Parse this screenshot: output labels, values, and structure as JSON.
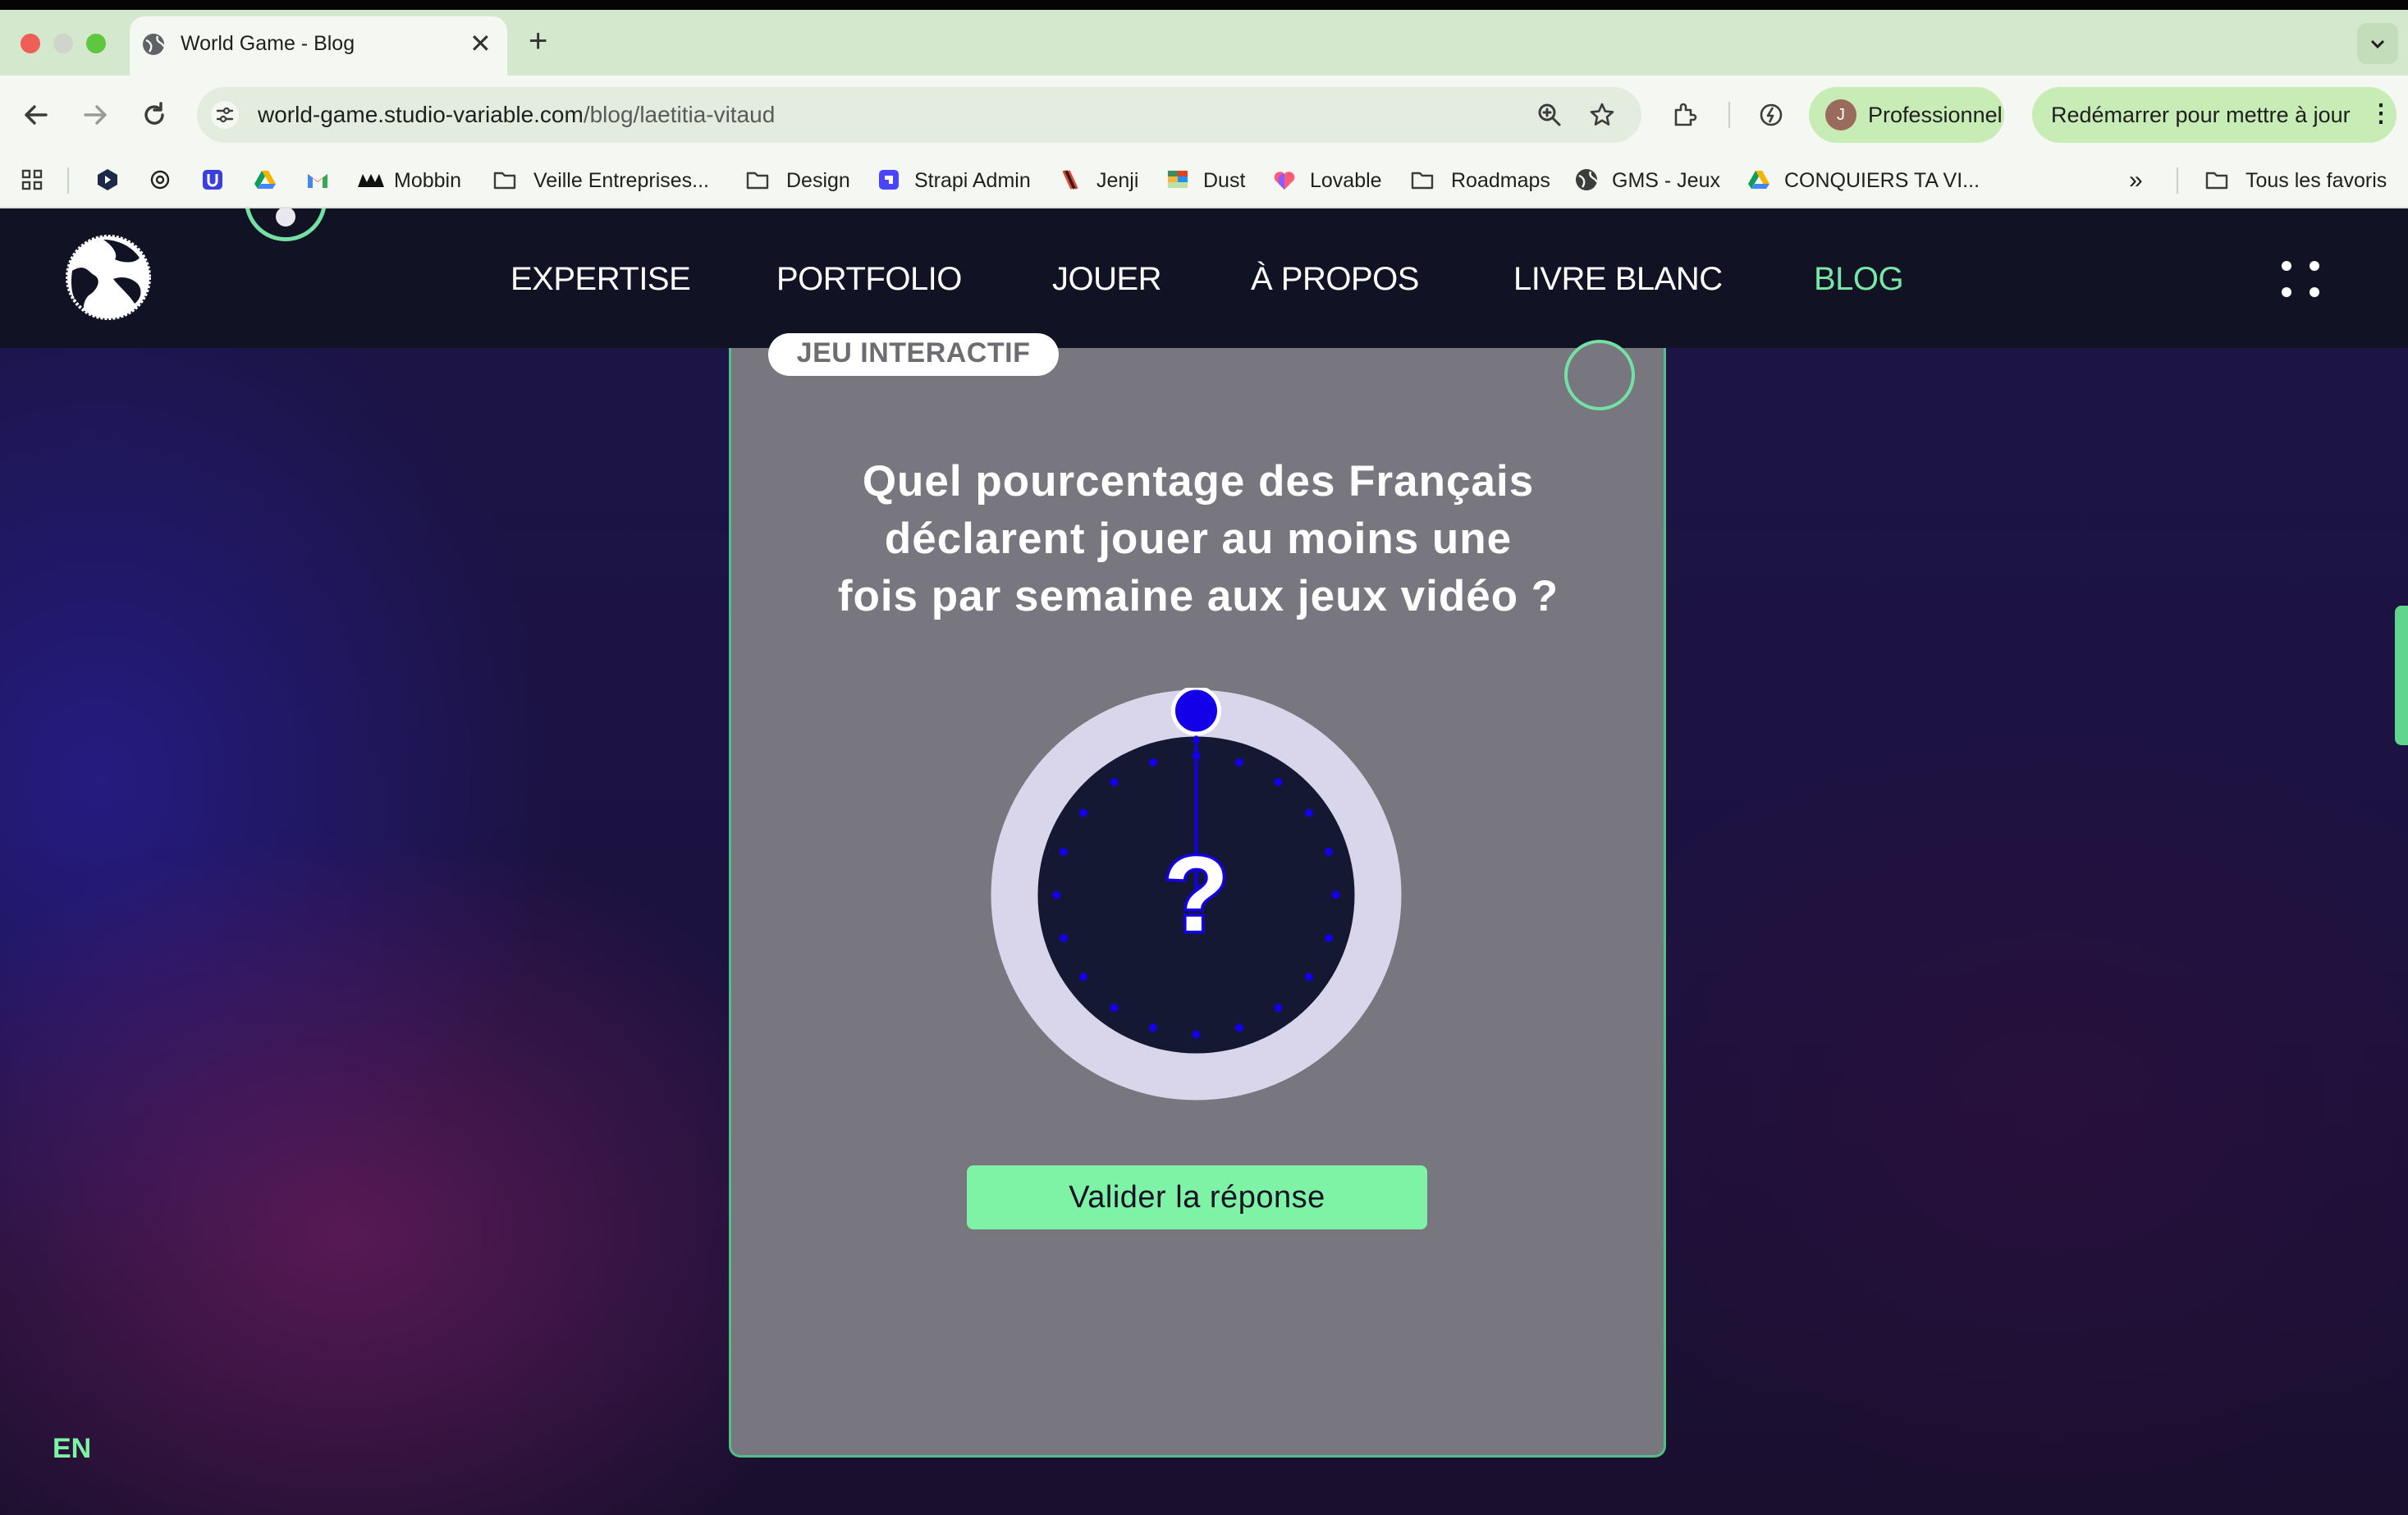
{
  "browser": {
    "tab": {
      "title": "World Game - Blog",
      "close": "✕"
    },
    "new_tab": "+",
    "url": {
      "host": "world-game.studio-variable.com",
      "path": "/blog/laetitia-vitaud"
    },
    "profile": {
      "initial": "J",
      "label": "Professionnel"
    },
    "restart": {
      "label": "Redémarrer pour mettre à jour",
      "menu": "⋮"
    },
    "bookmarks": [
      "Mobbin",
      "Veille Entreprises...",
      "Design",
      "Strapi Admin",
      "Jenji",
      "Dust",
      "Lovable",
      "Roadmaps",
      "GMS - Jeux",
      "CONQUIERS TA VI..."
    ],
    "bookmarks_overflow": "»",
    "all_bookmarks": "Tous les favoris"
  },
  "site": {
    "nav": [
      "EXPERTISE",
      "PORTFOLIO",
      "JOUER",
      "À PROPOS",
      "LIVRE BLANC",
      "BLOG"
    ],
    "active_nav": "BLOG",
    "language": "EN"
  },
  "quiz": {
    "chip": "JEU INTERACTIF",
    "question": "Quel pourcentage des Français\ndéclarent jouer au moins une\nfois par semaine aux jeux vidéo ?",
    "dial_center": "?",
    "dial_value_percent": 0,
    "validate_label": "Valider la réponse"
  },
  "colors": {
    "accent_green": "#7ef3a6",
    "active_nav": "#76e7a5",
    "dial_blue": "#1400e8",
    "dial_ring": "#d9d6ec",
    "dial_face": "#141833",
    "card_bg": "#78777f"
  },
  "icons": [
    "globe-icon",
    "back-arrow-icon",
    "forward-arrow-icon",
    "reload-icon",
    "site-settings-icon",
    "zoom-icon",
    "star-icon",
    "extensions-icon",
    "performance-icon",
    "apps-grid-icon",
    "folder-icon",
    "menu-dots-icon"
  ]
}
